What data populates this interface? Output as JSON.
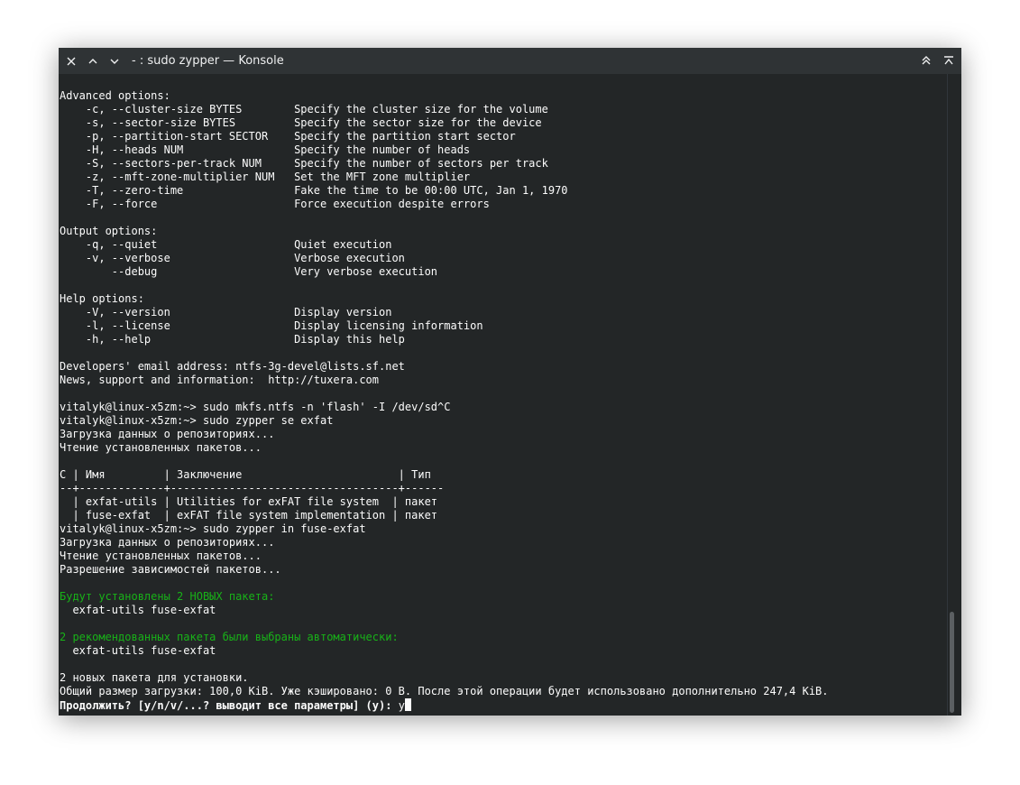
{
  "window": {
    "title": "- : sudo zypper — Konsole"
  },
  "colors": {
    "background": "#232627",
    "foreground": "#fcfcfc",
    "green": "#18b218",
    "titlebar": "#2f3335"
  },
  "icons": {
    "close": "close-icon",
    "keep_above": "chevron-up-icon",
    "keep_below": "chevron-down-icon",
    "shade": "double-chevron-up-icon",
    "maximize": "maximize-icon"
  },
  "terminal": {
    "lines": [
      {
        "text": "Advanced options:",
        "style": ""
      },
      {
        "text": "    -c, --cluster-size BYTES        Specify the cluster size for the volume",
        "style": ""
      },
      {
        "text": "    -s, --sector-size BYTES         Specify the sector size for the device",
        "style": ""
      },
      {
        "text": "    -p, --partition-start SECTOR    Specify the partition start sector",
        "style": ""
      },
      {
        "text": "    -H, --heads NUM                 Specify the number of heads",
        "style": ""
      },
      {
        "text": "    -S, --sectors-per-track NUM     Specify the number of sectors per track",
        "style": ""
      },
      {
        "text": "    -z, --mft-zone-multiplier NUM   Set the MFT zone multiplier",
        "style": ""
      },
      {
        "text": "    -T, --zero-time                 Fake the time to be 00:00 UTC, Jan 1, 1970",
        "style": ""
      },
      {
        "text": "    -F, --force                     Force execution despite errors",
        "style": ""
      },
      {
        "text": "",
        "style": ""
      },
      {
        "text": "Output options:",
        "style": ""
      },
      {
        "text": "    -q, --quiet                     Quiet execution",
        "style": ""
      },
      {
        "text": "    -v, --verbose                   Verbose execution",
        "style": ""
      },
      {
        "text": "        --debug                     Very verbose execution",
        "style": ""
      },
      {
        "text": "",
        "style": ""
      },
      {
        "text": "Help options:",
        "style": ""
      },
      {
        "text": "    -V, --version                   Display version",
        "style": ""
      },
      {
        "text": "    -l, --license                   Display licensing information",
        "style": ""
      },
      {
        "text": "    -h, --help                      Display this help",
        "style": ""
      },
      {
        "text": "",
        "style": ""
      },
      {
        "text": "Developers' email address: ntfs-3g-devel@lists.sf.net",
        "style": ""
      },
      {
        "text": "News, support and information:  http://tuxera.com",
        "style": ""
      },
      {
        "text": "",
        "style": ""
      },
      {
        "text": "vitalyk@linux-x5zm:~> sudo mkfs.ntfs -n 'flash' -I /dev/sd^C",
        "style": ""
      },
      {
        "text": "vitalyk@linux-x5zm:~> sudo zypper se exfat",
        "style": ""
      },
      {
        "text": "Загрузка данных о репозиториях...",
        "style": ""
      },
      {
        "text": "Чтение установленных пакетов...",
        "style": ""
      },
      {
        "text": "",
        "style": ""
      },
      {
        "text": "С | Имя         | Заключение                        | Тип",
        "style": ""
      },
      {
        "text": "--+-------------+-----------------------------------+------",
        "style": ""
      },
      {
        "text": "  | exfat-utils | Utilities for exFAT file system  | пакет",
        "style": ""
      },
      {
        "text": "  | fuse-exfat  | exFAT file system implementation | пакет",
        "style": ""
      },
      {
        "text": "vitalyk@linux-x5zm:~> sudo zypper in fuse-exfat",
        "style": ""
      },
      {
        "text": "Загрузка данных о репозиториях...",
        "style": ""
      },
      {
        "text": "Чтение установленных пакетов...",
        "style": ""
      },
      {
        "text": "Разрешение зависимостей пакетов...",
        "style": ""
      },
      {
        "text": "",
        "style": ""
      },
      {
        "text": "Будут установлены 2 НОВЫХ пакета:",
        "style": "green"
      },
      {
        "text": "  exfat-utils fuse-exfat",
        "style": ""
      },
      {
        "text": "",
        "style": ""
      },
      {
        "text": "2 рекомендованных пакета были выбраны автоматически:",
        "style": "green"
      },
      {
        "text": "  exfat-utils fuse-exfat",
        "style": ""
      },
      {
        "text": "",
        "style": ""
      },
      {
        "text": "2 новых пакета для установки.",
        "style": ""
      },
      {
        "text": "Общий размер загрузки: 100,0 KiB. Уже кэшировано: 0 B. После этой операции будет использовано дополнительно 247,4 KiB.",
        "style": ""
      }
    ],
    "prompt_text": "Продолжить? [y/n/v/...? выводит все параметры] (y): ",
    "input_value": "y"
  }
}
